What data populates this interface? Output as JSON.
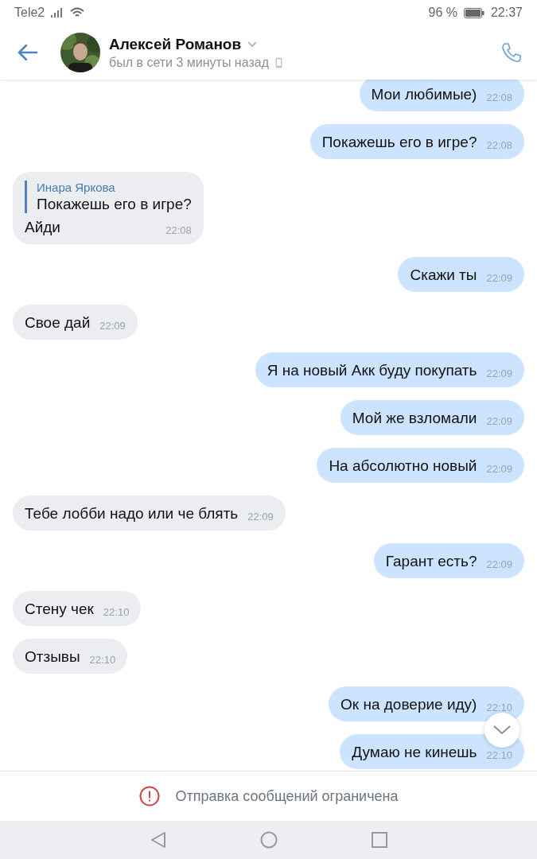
{
  "status_bar": {
    "carrier": "Tele2",
    "battery": "96 %",
    "time": "22:37"
  },
  "header": {
    "name": "Алексей Романов",
    "presence": "был в сети 3 минуты назад"
  },
  "messages": [
    {
      "outgoing": true,
      "text": "Мои любимые)",
      "time": "22:08"
    },
    {
      "outgoing": true,
      "text": "Покажешь его в игре?",
      "time": "22:08"
    },
    {
      "outgoing": false,
      "reply": {
        "author": "Инара Яркова",
        "text": "Покажешь его в игре?"
      },
      "text": "Айди",
      "time": "22:08"
    },
    {
      "outgoing": true,
      "text": "Скажи ты",
      "time": "22:09"
    },
    {
      "outgoing": false,
      "text": "Свое дай",
      "time": "22:09"
    },
    {
      "outgoing": true,
      "text": "Я на новый Акк буду покупать",
      "time": "22:09"
    },
    {
      "outgoing": true,
      "text": "Мой же взломали",
      "time": "22:09"
    },
    {
      "outgoing": true,
      "text": "На абсолютно новый",
      "time": "22:09"
    },
    {
      "outgoing": false,
      "text": "Тебе лобби надо или че блять",
      "time": "22:09"
    },
    {
      "outgoing": true,
      "text": "Гарант есть?",
      "time": "22:09"
    },
    {
      "outgoing": false,
      "text": "Стену чек",
      "time": "22:10"
    },
    {
      "outgoing": false,
      "text": "Отзывы",
      "time": "22:10"
    },
    {
      "outgoing": true,
      "text": "Ок на доверие иду)",
      "time": "22:10"
    },
    {
      "outgoing": true,
      "text": "Думаю не кинешь",
      "time": "22:10"
    }
  ],
  "notice": "Отправка сообщений ограничена"
}
